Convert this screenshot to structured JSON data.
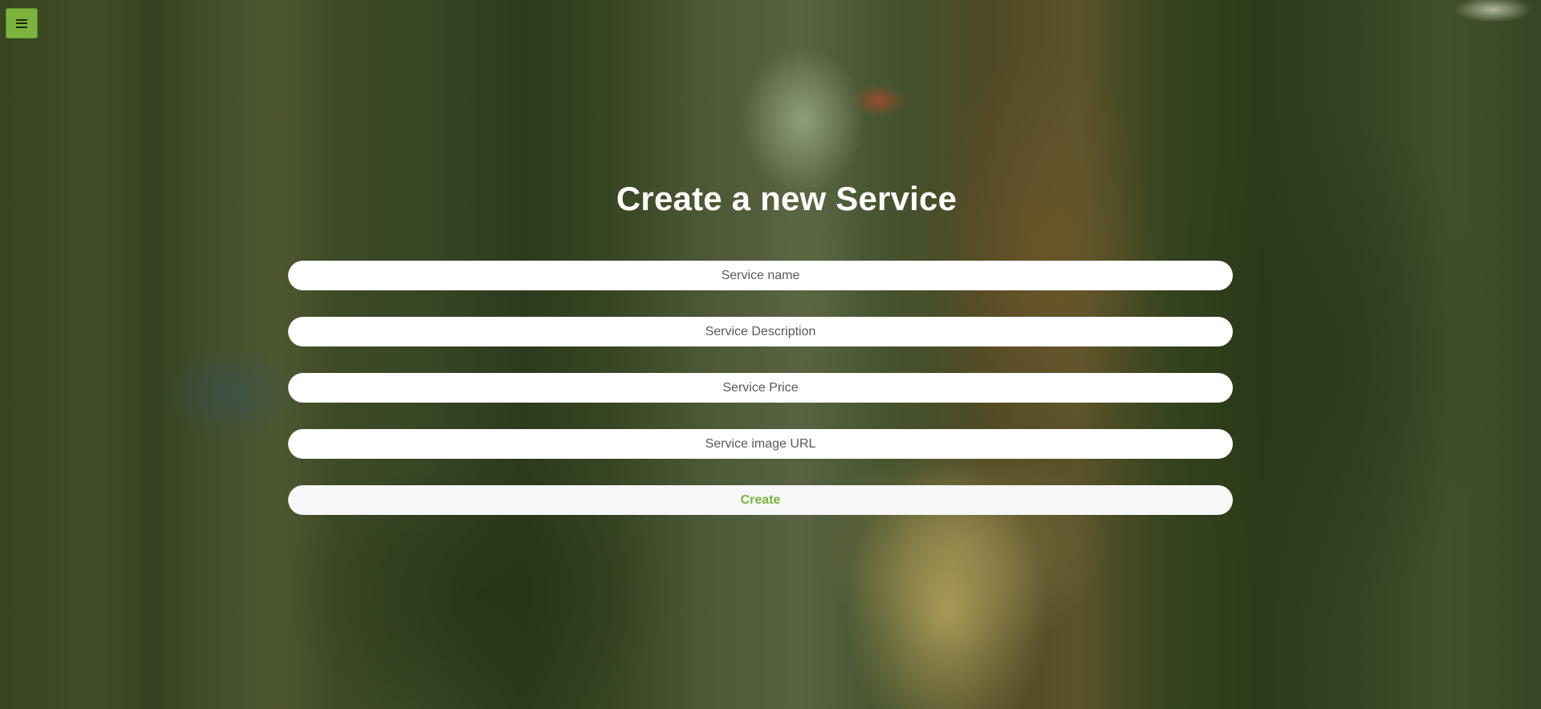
{
  "header": {
    "menu_icon": "hamburger-menu-icon"
  },
  "form": {
    "title": "Create a new Service",
    "fields": {
      "name_placeholder": "Service name",
      "description_placeholder": "Service Description",
      "price_placeholder": "Service Price",
      "image_url_placeholder": "Service image URL"
    },
    "submit_label": "Create"
  },
  "colors": {
    "accent": "#7db33c",
    "title_text": "#ffffff",
    "field_background": "#ffffff"
  }
}
